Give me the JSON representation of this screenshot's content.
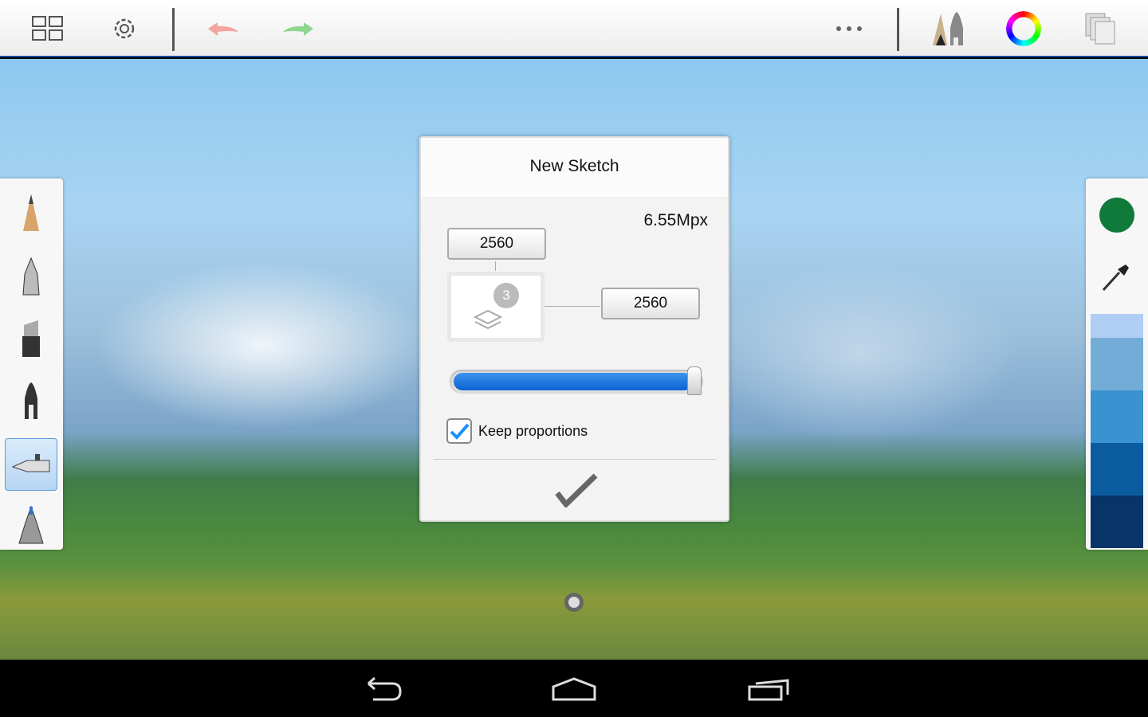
{
  "toolbar": {
    "icons": [
      "gallery-grid-icon",
      "settings-gear-icon",
      "undo-icon",
      "redo-icon",
      "more-icon",
      "brush-library-icon",
      "color-wheel-icon",
      "layers-icon"
    ]
  },
  "left_tools": [
    "pencil",
    "ballpoint-pen",
    "marker",
    "ink-pen",
    "airbrush",
    "paint-brush"
  ],
  "selected_tool": "airbrush",
  "right_panel": {
    "current_color": "#0f7a3a",
    "swatches": [
      "#b0cdf4",
      "#74acd8",
      "#3b92d0",
      "#0a5c9e",
      "#083468"
    ]
  },
  "dialog": {
    "title": "New Sketch",
    "megapixels": "6.55Mpx",
    "width": "2560",
    "height": "2560",
    "layers": "3",
    "size_slider": 1.0,
    "keep_proportions_label": "Keep proportions",
    "keep_proportions": true,
    "confirm_icon": "checkmark-icon"
  },
  "navbar": {
    "icons": [
      "back-icon",
      "home-icon",
      "recent-apps-icon"
    ]
  }
}
